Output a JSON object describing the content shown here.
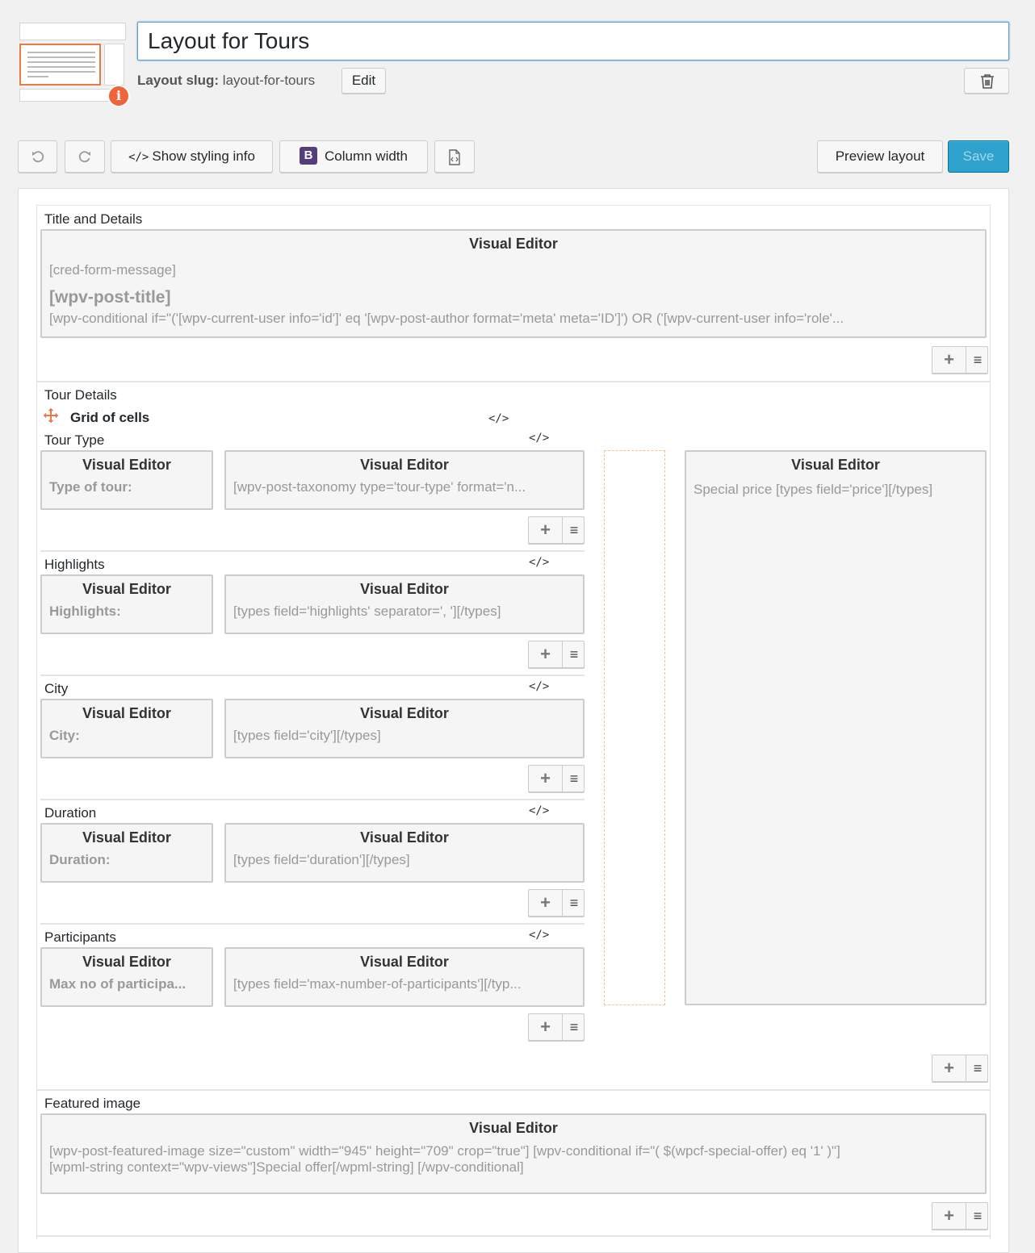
{
  "header": {
    "layout_title": "Layout for Tours",
    "slug_label": "Layout slug:",
    "slug_value": "layout-for-tours",
    "edit_label": "Edit",
    "info_icon": "info-icon",
    "trash_icon": "trash-icon"
  },
  "toolbar": {
    "undo_icon": "undo-icon",
    "redo_icon": "redo-icon",
    "styling_label": "Show styling info",
    "styling_icon": "</>",
    "column_width_badge": "B",
    "column_width_label": "Column width",
    "css_icon": "css-file-icon",
    "preview_label": "Preview layout",
    "save_label": "Save"
  },
  "rows": {
    "title_details": {
      "label": "Title and Details",
      "cell_title": "Visual Editor",
      "line1": "[cred-form-message]",
      "line2": "[wpv-post-title]",
      "line3": "[wpv-conditional if=\"('[wpv-current-user info='id']' eq '[wpv-post-author format='meta' meta='ID']') OR ('[wpv-current-user info='role'..."
    },
    "tour_details": {
      "label": "Tour Details",
      "grid_label": "Grid of cells",
      "code_icon": "</>",
      "side_cell_title": "Visual Editor",
      "side_cell_body": "Special price [types field='price'][/types]",
      "subrows": [
        {
          "label": "Tour Type",
          "code_icon": "</>",
          "left_title": "Visual Editor",
          "left_body": "Type of tour:",
          "right_title": "Visual Editor",
          "right_body": "[wpv-post-taxonomy type='tour-type' format='n..."
        },
        {
          "label": "Highlights",
          "code_icon": "</>",
          "left_title": "Visual Editor",
          "left_body": "Highlights:",
          "right_title": "Visual Editor",
          "right_body": "[types field='highlights' separator=', '][/types]"
        },
        {
          "label": "City",
          "code_icon": "</>",
          "left_title": "Visual Editor",
          "left_body": "City:",
          "right_title": "Visual Editor",
          "right_body": "[types field='city'][/types]"
        },
        {
          "label": "Duration",
          "code_icon": "</>",
          "left_title": "Visual Editor",
          "left_body": "Duration:",
          "right_title": "Visual Editor",
          "right_body": "[types field='duration'][/types]"
        },
        {
          "label": "Participants",
          "code_icon": "</>",
          "left_title": "Visual Editor",
          "left_body": "Max no of participa...",
          "right_title": "Visual Editor",
          "right_body": "[types field='max-number-of-participants'][/typ..."
        }
      ]
    },
    "featured_image": {
      "label": "Featured image",
      "cell_title": "Visual Editor",
      "line1": "[wpv-post-featured-image size=\"custom\" width=\"945\" height=\"709\" crop=\"true\"] [wpv-conditional if=\"( $(wpcf-special-offer) eq '1' )\"]",
      "line2": "[wpml-string context=\"wpv-views\"]Special offer[/wpml-string] [/wpv-conditional]"
    }
  },
  "controls": {
    "plus": "+",
    "menu": "≡"
  }
}
